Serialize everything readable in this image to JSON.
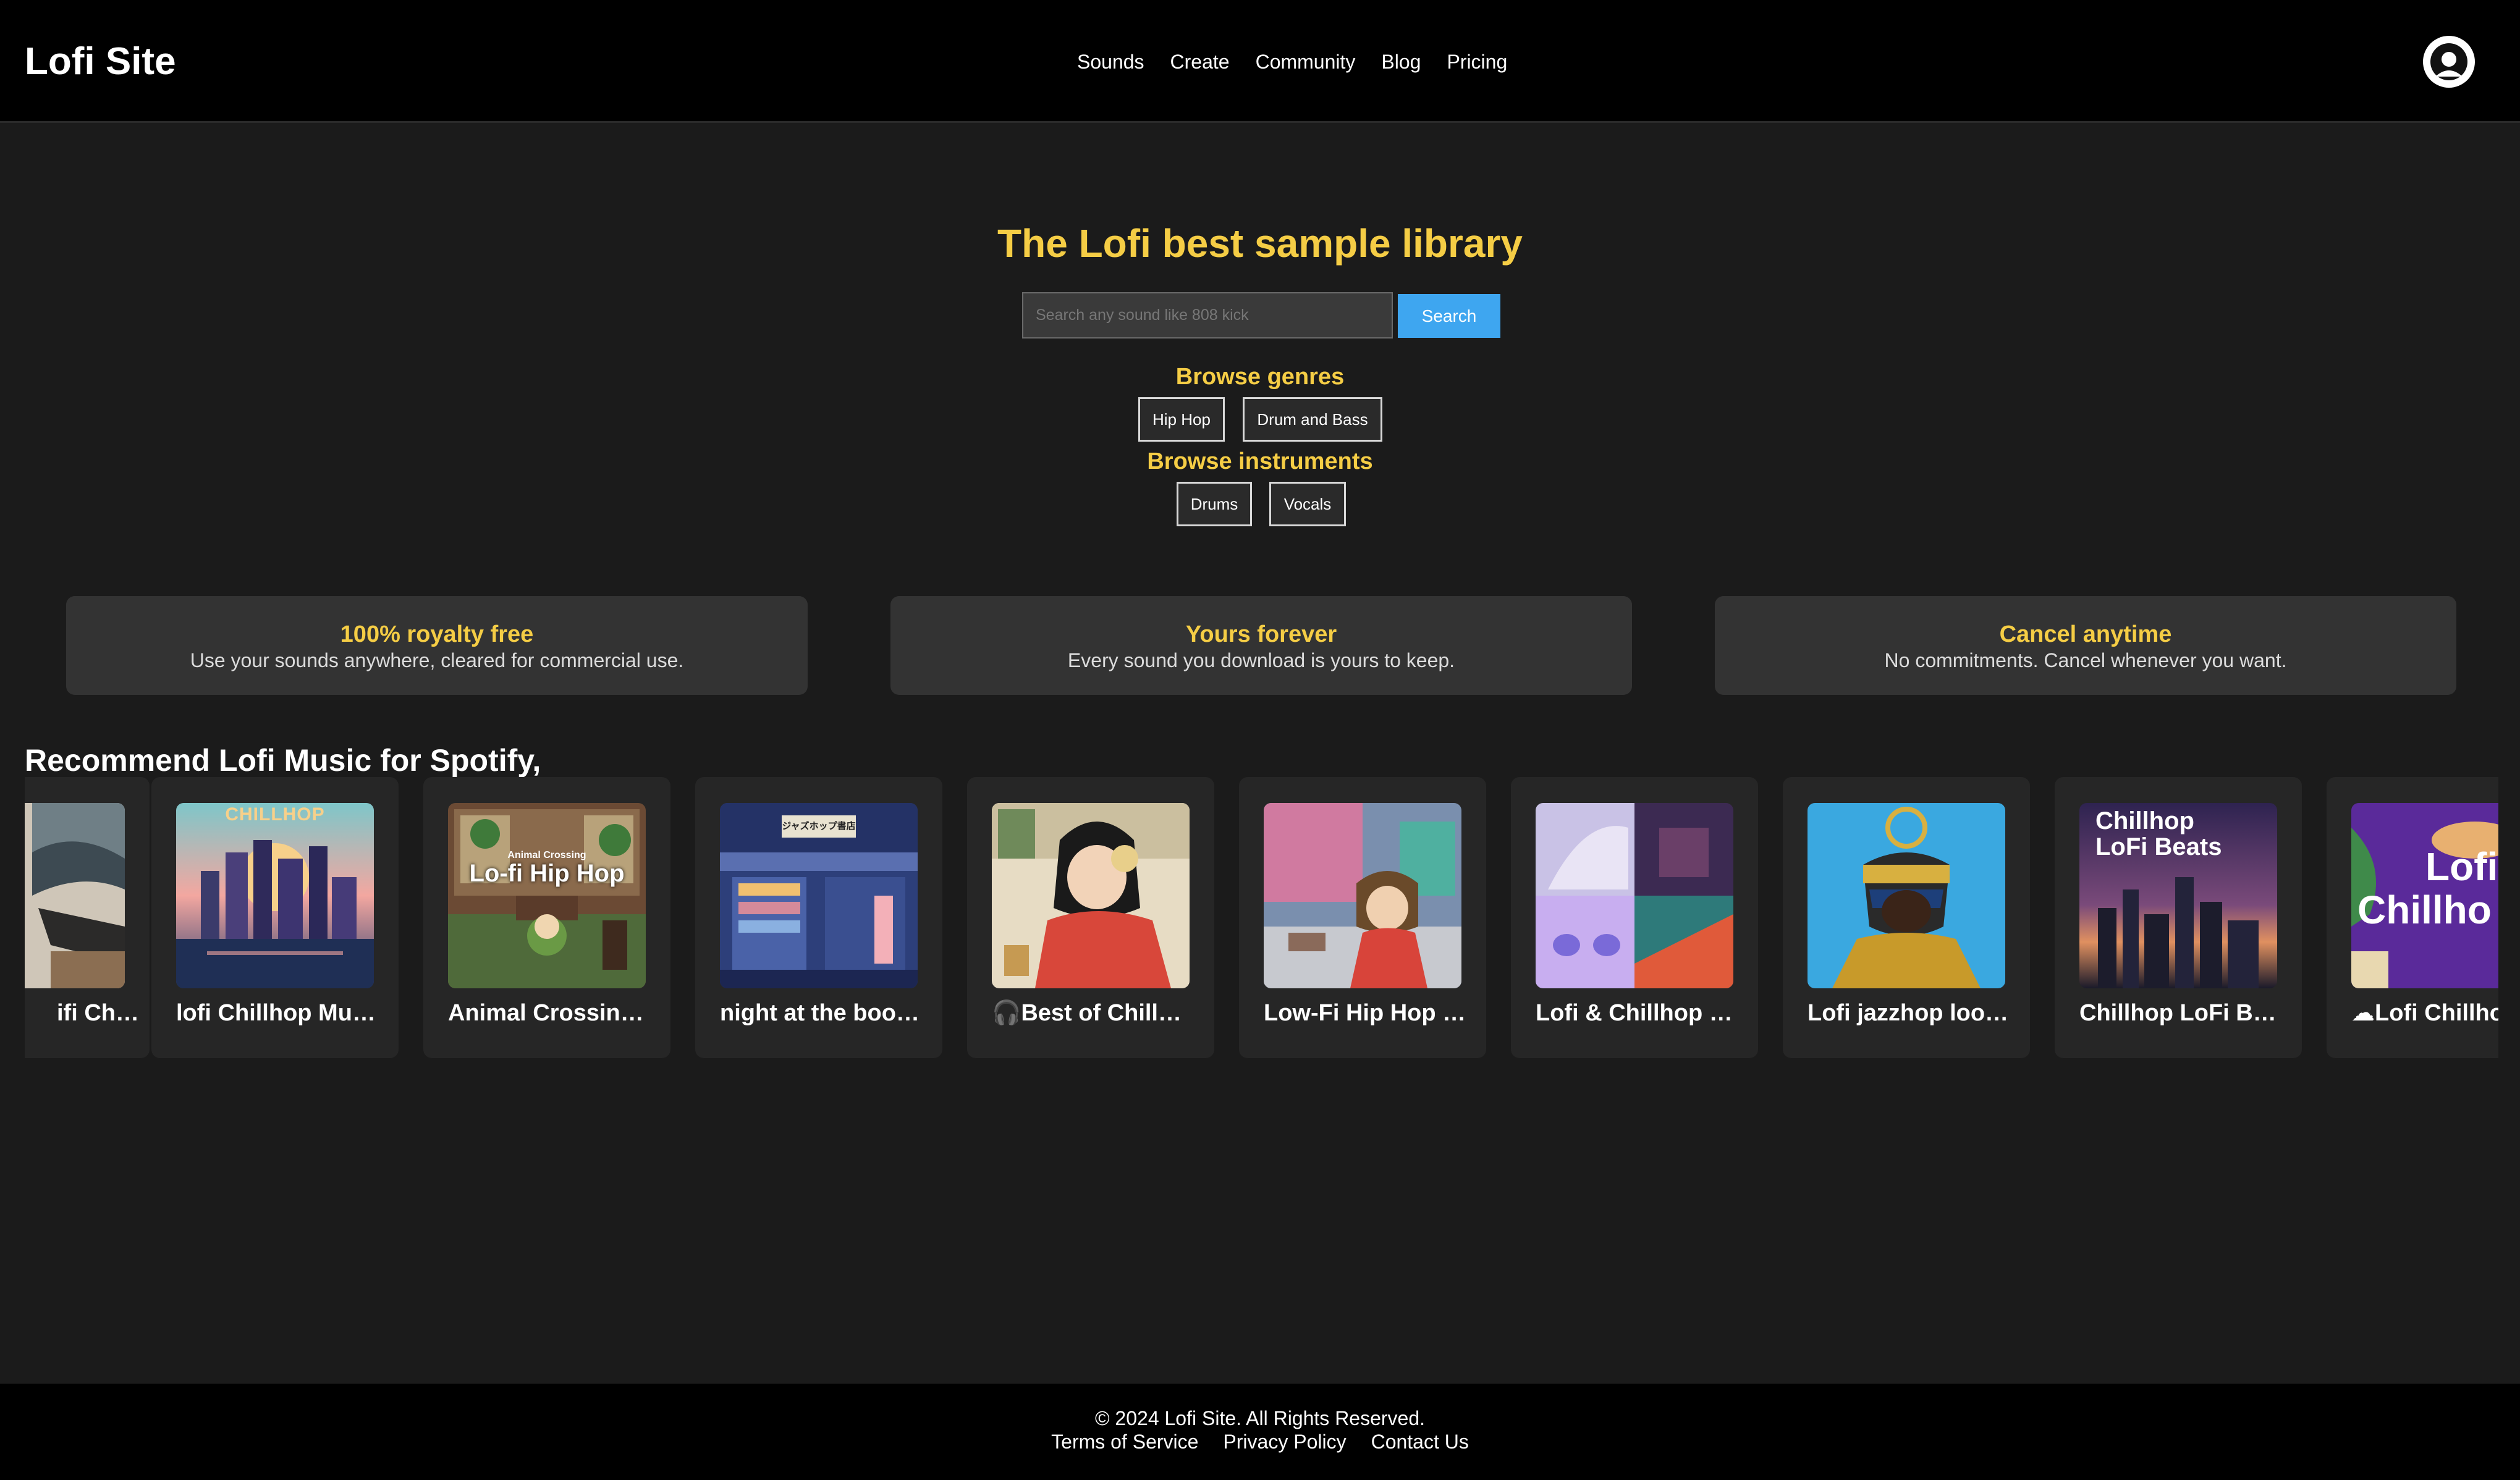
{
  "header": {
    "logo": "Lofi Site",
    "nav": [
      "Sounds",
      "Create",
      "Community",
      "Blog",
      "Pricing"
    ],
    "avatar_icon": "user-avatar-icon"
  },
  "hero": {
    "title": "The Lofi best sample library",
    "search": {
      "placeholder": "Search any sound like 808 kick",
      "button_label": "Search"
    },
    "genres_label": "Browse genres",
    "genres": [
      "Hip Hop",
      "Drum and Bass"
    ],
    "instruments_label": "Browse instruments",
    "instruments": [
      "Drums",
      "Vocals"
    ]
  },
  "features": [
    {
      "title": "100% royalty free",
      "desc": "Use your sounds anywhere, cleared for commercial use."
    },
    {
      "title": "Yours forever",
      "desc": "Every sound you download is yours to keep."
    },
    {
      "title": "Cancel anytime",
      "desc": "No commitments. Cancel whenever you want."
    }
  ],
  "recommend": {
    "title": "Recommend Lofi Music for Spotify,",
    "playlists": [
      "ifi Ch…",
      "lofi Chillhop Music",
      "Animal Crossin…",
      "night at the boo…",
      "🎧Best of Chillh…",
      "Low-Fi Hip Hop …",
      "Lofi & Chillhop …",
      "Lofi jazzhop loops",
      "Chillhop LoFi B…",
      "☁Lofi Chillho"
    ],
    "cover_texts": {
      "chillhop": "CHILLHOP",
      "animal_small": "Animal Crossing",
      "animal_big": "Lo-fi Hip Hop",
      "bookstore_sign": "ジャズホップ書店",
      "chillhop_beats_1": "Chillhop",
      "chillhop_beats_2": "LoFi Beats",
      "lofi_chill_1": "Lofi",
      "lofi_chill_2": "Chillho"
    }
  },
  "footer": {
    "copyright": "© 2024 Lofi Site. All Rights Reserved.",
    "links": [
      "Terms of Service",
      "Privacy Policy",
      "Contact Us"
    ]
  },
  "colors": {
    "accent_yellow": "#f5cd45",
    "search_blue": "#3ea6f0",
    "background": "#1b1b1b",
    "header_bg": "#000000"
  }
}
